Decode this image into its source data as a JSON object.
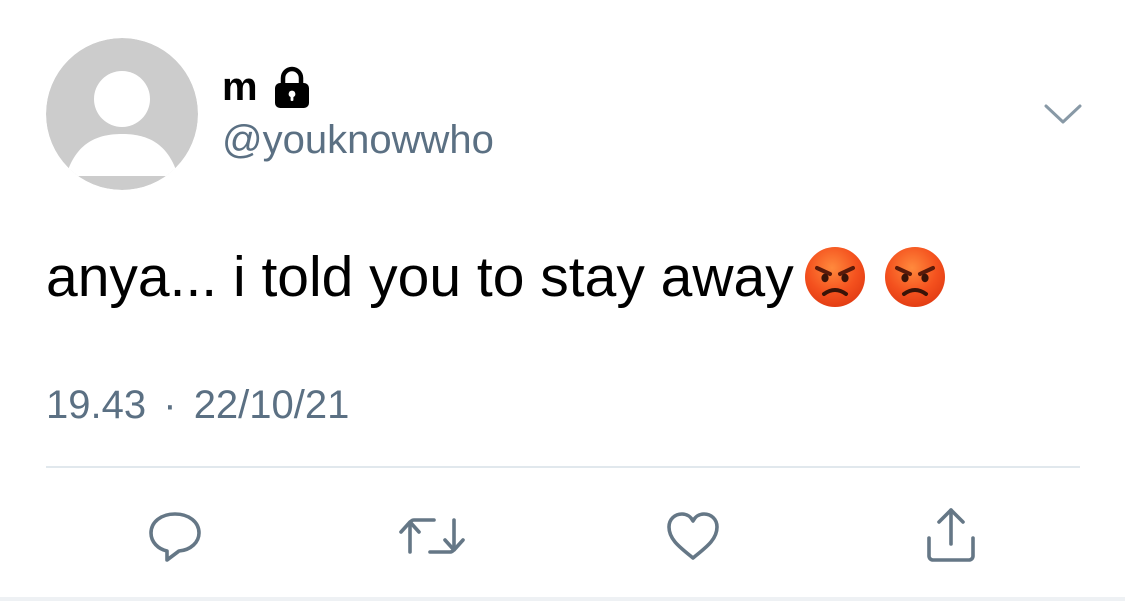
{
  "user": {
    "display_name": "m",
    "handle": "@youknowwho",
    "protected": true,
    "avatar": "default-avatar"
  },
  "tweet": {
    "text": "anya... i told you to stay away",
    "emojis": [
      "angry-face-emoji",
      "angry-face-emoji"
    ],
    "time": "19.43",
    "separator": "·",
    "date": "22/10/21"
  },
  "actions": [
    {
      "name": "reply",
      "icon": "reply-icon"
    },
    {
      "name": "retweet",
      "icon": "retweet-icon"
    },
    {
      "name": "like",
      "icon": "heart-icon"
    },
    {
      "name": "share",
      "icon": "share-icon"
    }
  ],
  "colors": {
    "secondary_text": "#5b7083",
    "divider": "#e1e8ed",
    "avatar_fill": "#cccccc",
    "emoji_orange": "#f4511e"
  }
}
